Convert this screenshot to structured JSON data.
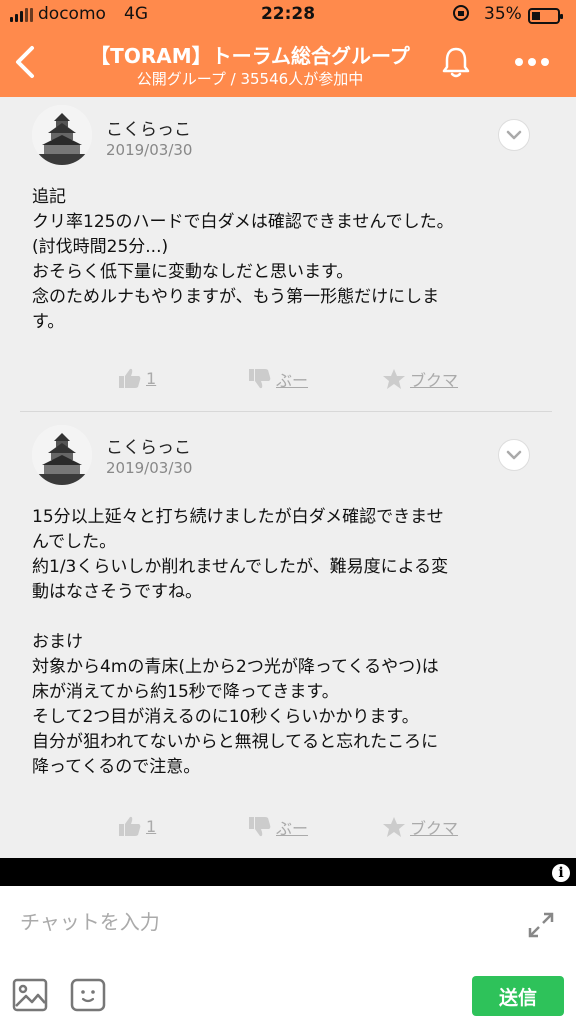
{
  "status_bar": {
    "carrier": "docomo",
    "network": "4G",
    "time": "22:28",
    "battery": "35%"
  },
  "header": {
    "title": "【TORAM】トーラム総合グループ",
    "subtitle": "公開グループ / 35546人が参加中",
    "accent_color": "#ff8a4c",
    "icons": [
      "chevron-left-icon",
      "bell-icon",
      "more-icon"
    ]
  },
  "posts": [
    {
      "author": "こくらっこ",
      "date": "2019/03/30",
      "lines": [
        "追記",
        "クリ率125のハードで白ダメは確認できませんでした。",
        "(討伐時間25分...)",
        "おそらく低下量に変動なしだと思います。",
        "念のためルナもやりますが、もう第一形態だけにしま",
        "す。"
      ],
      "likes": "1",
      "dislike_label": "ぶー",
      "bookmark_label": "ブクマ"
    },
    {
      "author": "こくらっこ",
      "date": "2019/03/30",
      "lines": [
        "15分以上延々と打ち続けましたが白ダメ確認できませ",
        "んでした。",
        "約1/3くらいしか削れませんでしたが、難易度による変",
        "動はなさそうですね。",
        "",
        "おまけ",
        "対象から4mの青床(上から2つ光が降ってくるやつ)は",
        "床が消えてから約15秒で降ってきます。",
        "そして2つ目が消えるのに10秒くらいかかります。",
        "自分が狙われてないからと無視してると忘れたころに",
        "降ってくるので注意。"
      ],
      "likes": "1",
      "dislike_label": "ぶー",
      "bookmark_label": "ブクマ"
    }
  ],
  "chat": {
    "placeholder": "チャットを入力",
    "send_label": "送信",
    "send_color": "#2ec25a"
  }
}
